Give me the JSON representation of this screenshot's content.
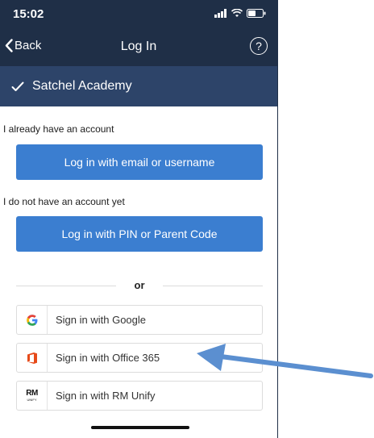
{
  "status_bar": {
    "time": "15:02",
    "bar_color": "#1f2f47"
  },
  "nav": {
    "back_label": "Back",
    "title": "Log In",
    "help_label": "?",
    "back_icon": "chevron-left-icon",
    "help_icon": "question-circle-icon"
  },
  "school": {
    "name": "Satchel Academy",
    "icon": "check-icon",
    "bar_color": "#2d4469"
  },
  "existing_account": {
    "label": "I already have an account",
    "button_label": "Log in with email or username"
  },
  "new_account": {
    "label": "I do not have an account yet",
    "button_label": "Log in with PIN or Parent Code"
  },
  "divider": {
    "text": "or"
  },
  "sso": {
    "google": {
      "label": "Sign in with Google",
      "icon": "google-icon"
    },
    "office": {
      "label": "Sign in with Office 365",
      "icon": "office-icon"
    },
    "rm": {
      "label": "Sign in with RM Unify",
      "icon": "rm-unify-icon",
      "logo_text": "RM",
      "logo_subtext": "UNIFY"
    }
  },
  "colors": {
    "primary_button": "#3b7ed0",
    "annotation_arrow": "#5b8fd0"
  }
}
